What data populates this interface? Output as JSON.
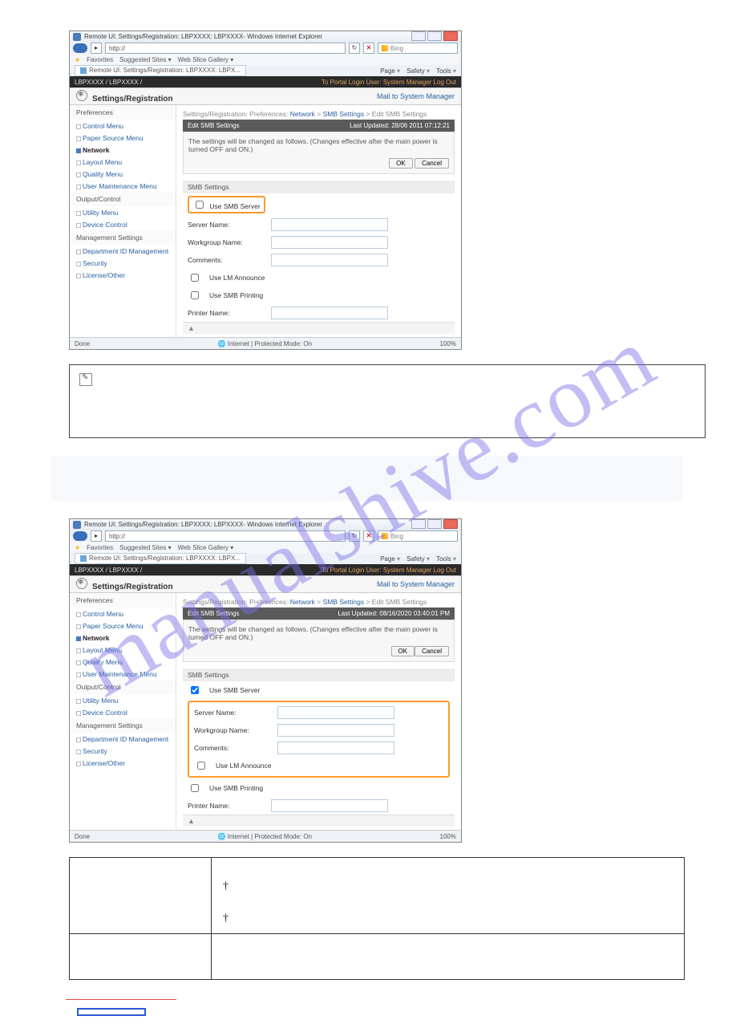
{
  "watermark": "manualshive.com",
  "browser": {
    "title": "Remote UI: Settings/Registration: LBPXXXX: LBPXXXX- Windows Internet Explorer",
    "url": "http://",
    "search": "Bing",
    "favorites_label": "Favorites",
    "suggested": "Suggested Sites ▾",
    "webslice": "Web Slice Gallery ▾",
    "tab": "Remote UI: Settings/Registration: LBPXXXX: LBPX...",
    "tools": {
      "page": "Page",
      "safety": "Safety",
      "tools": "Tools"
    },
    "status_done": "Done",
    "status_net": "Internet | Protected Mode: On",
    "zoom": "100%"
  },
  "portal": {
    "device": "LBPXXXX / LBPXXXX /",
    "links": "To Portal   Login User: System Manager Log Out",
    "sr_title": "Settings/Registration",
    "mail_link": "Mail to System Manager"
  },
  "sidebar": {
    "preferences": "Preferences",
    "items1": [
      "Control Menu",
      "Paper Source Menu",
      "Network",
      "Layout Menu",
      "Quality Menu",
      "User Maintenance Menu"
    ],
    "output": "Output/Control",
    "items2": [
      "Utility Menu",
      "Device Control"
    ],
    "mgmt": "Management Settings",
    "items3": [
      "Department ID Management",
      "Security",
      "License/Other"
    ]
  },
  "crumb": {
    "text_a": "Settings/Registration: Preferences:",
    "net": "Network",
    "smb": "SMB Settings",
    "edit": "Edit SMB Settings"
  },
  "editbar1": {
    "title": "Edit SMB Settings",
    "updated": "Last Updated: 28/06 2011 07:12:21"
  },
  "editbar2": {
    "title": "Edit SMB Settings",
    "updated": "Last Updated: 08/16/2020 03:40:01 PM"
  },
  "notice": "The settings will be changed as follows. (Changes effective after the main power is turned OFF and ON.)",
  "btn": {
    "ok": "OK",
    "cancel": "Cancel"
  },
  "smb": {
    "section": "SMB Settings",
    "use_server": "Use SMB Server",
    "server_name": "Server Name:",
    "workgroup": "Workgroup Name:",
    "comments": "Comments:",
    "lm": "Use LM Announce",
    "printing": "Use SMB Printing",
    "printer": "Printer Name:"
  },
  "pager": "▲"
}
